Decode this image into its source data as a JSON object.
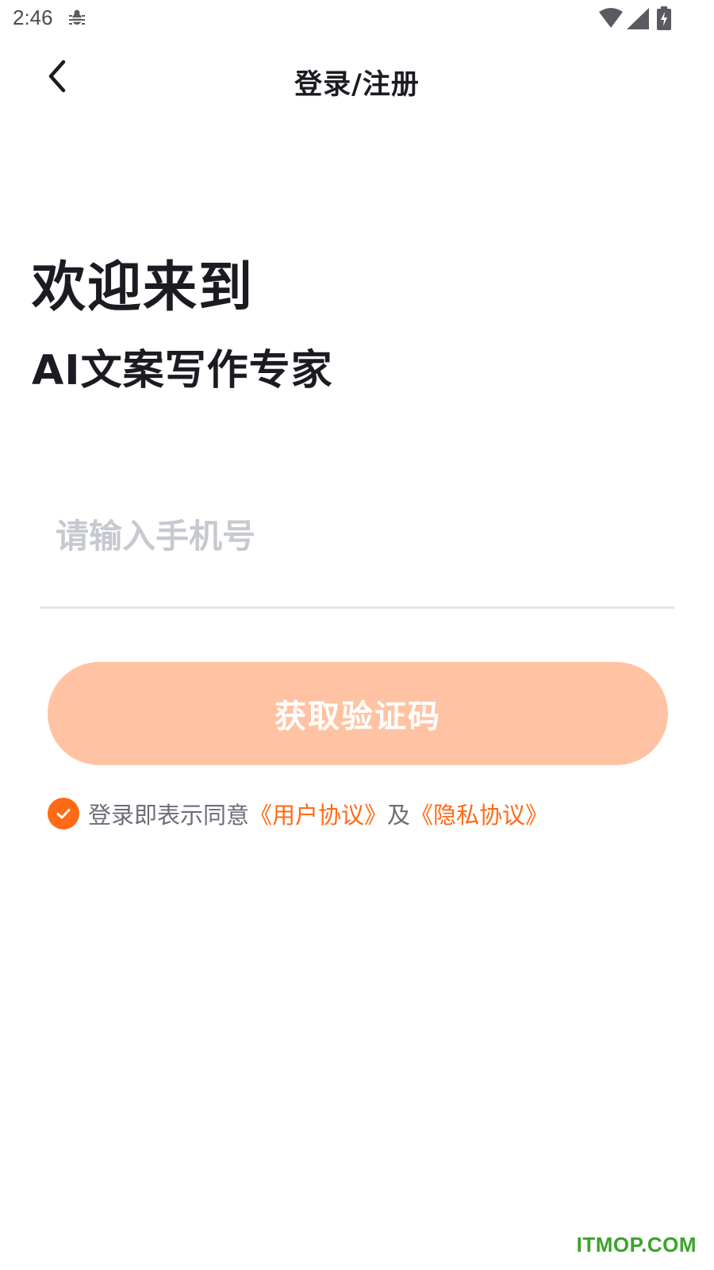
{
  "status_bar": {
    "time": "2:46"
  },
  "header": {
    "title": "登录/注册"
  },
  "welcome": {
    "line1": "欢迎来到",
    "line2": "AI文案写作专家"
  },
  "phone_input": {
    "value": "",
    "placeholder": "请输入手机号"
  },
  "get_code_button": {
    "label": "获取验证码",
    "enabled": false
  },
  "agreement": {
    "checked": true,
    "prefix": "登录即表示同意",
    "user_agreement": "《用户协议》",
    "conjunction": "及",
    "privacy_agreement": "《隐私协议》"
  },
  "watermark": {
    "text": "ITMOP.COM"
  },
  "icons": {
    "back": "chevron-left-icon",
    "debug": "bug-icon",
    "wifi": "wifi-icon",
    "signal": "cellular-signal-icon",
    "battery": "battery-charging-icon",
    "check": "checkmark-icon"
  },
  "colors": {
    "accent": "#ff6a14",
    "button_disabled_bg": "#ffc3a3",
    "title_text": "#1b1b22",
    "placeholder": "#c7c9d0",
    "secondary_text": "#6b6d78",
    "divider": "#e4e4ea"
  }
}
